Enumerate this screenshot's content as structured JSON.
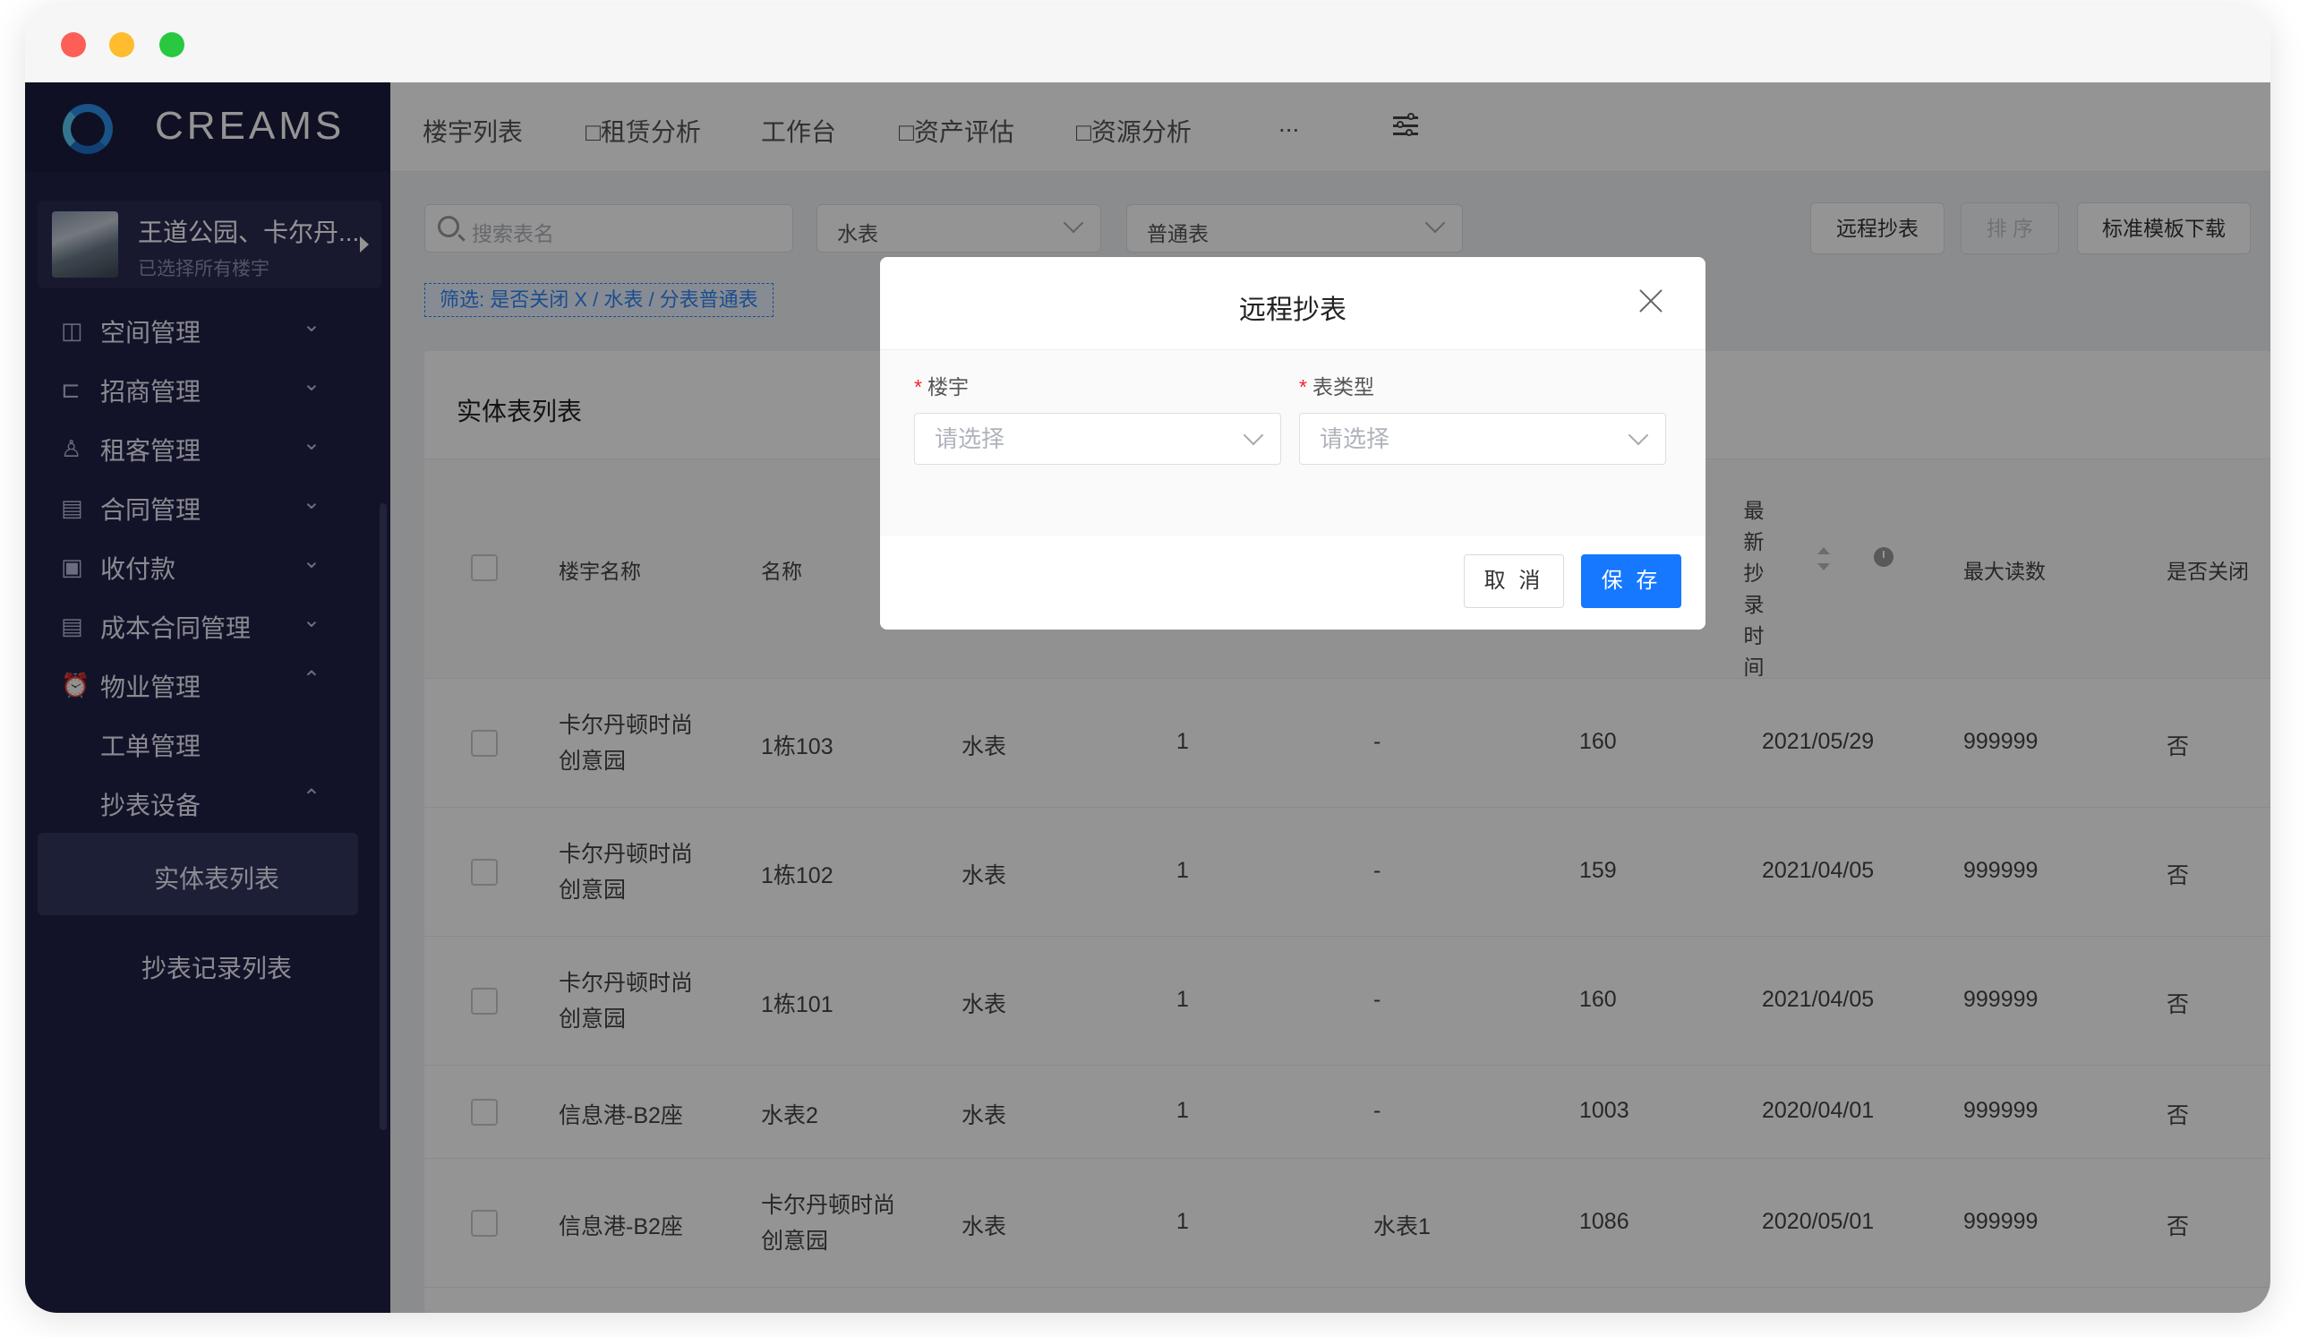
{
  "brand": {
    "name": "CREAMS"
  },
  "project": {
    "name": "王道公园、卡尔丹...",
    "subtitle": "已选择所有楼宇"
  },
  "sidebar": {
    "items": [
      {
        "label": "空间管理",
        "icon": "space-icon",
        "chevron": "⌄"
      },
      {
        "label": "招商管理",
        "icon": "investment-icon",
        "chevron": "⌄"
      },
      {
        "label": "租客管理",
        "icon": "tenant-icon",
        "chevron": "⌄"
      },
      {
        "label": "合同管理",
        "icon": "contract-icon",
        "chevron": "⌄"
      },
      {
        "label": "收付款",
        "icon": "payment-icon",
        "chevron": "⌄"
      },
      {
        "label": "成本合同管理",
        "icon": "cost-contract-icon",
        "chevron": "⌄"
      },
      {
        "label": "物业管理",
        "icon": "property-icon",
        "chevron": "⌃"
      }
    ],
    "sub_items": [
      {
        "label": "工单管理"
      },
      {
        "label": "抄表设备",
        "chevron": "⌃"
      }
    ],
    "active_item": {
      "label": "实体表列表"
    },
    "partial_item": {
      "label": "抄表记录列表"
    }
  },
  "topnav": {
    "tabs": [
      "楼宇列表",
      "□租赁分析",
      "工作台",
      "□资产评估",
      "□资源分析",
      "..."
    ]
  },
  "toolbar": {
    "search_placeholder": "搜索表名",
    "meter_type_value": "水表",
    "table_type_value": "普通表",
    "remote_read_label": "远程抄表",
    "sort_label": "排 序",
    "template_download_label": "标准模板下载"
  },
  "filter": {
    "text": "筛选:  是否关闭   X   /   水表   /   分表普通表"
  },
  "table": {
    "title": "实体表列表",
    "headers": {
      "building": "楼宇名称",
      "name": "名称",
      "latest_time": "最新抄录时间",
      "max_reading": "最大读数",
      "closed": "是否关闭"
    },
    "rows": [
      {
        "building": [
          "卡尔丹顿时尚",
          "创意园"
        ],
        "name": [
          "1栋103"
        ],
        "type": "水表",
        "multiplier": "1",
        "parent": "-",
        "reading": "160",
        "date": "2021/05/29",
        "max": "999999",
        "closed": "否"
      },
      {
        "building": [
          "卡尔丹顿时尚",
          "创意园"
        ],
        "name": [
          "1栋102"
        ],
        "type": "水表",
        "multiplier": "1",
        "parent": "-",
        "reading": "159",
        "date": "2021/04/05",
        "max": "999999",
        "closed": "否"
      },
      {
        "building": [
          "卡尔丹顿时尚",
          "创意园"
        ],
        "name": [
          "1栋101"
        ],
        "type": "水表",
        "multiplier": "1",
        "parent": "-",
        "reading": "160",
        "date": "2021/04/05",
        "max": "999999",
        "closed": "否"
      },
      {
        "building": [
          "信息港-B2座"
        ],
        "name": [
          "水表2"
        ],
        "type": "水表",
        "multiplier": "1",
        "parent": "-",
        "reading": "1003",
        "date": "2020/04/01",
        "max": "999999",
        "closed": "否"
      },
      {
        "building": [
          "信息港-B2座"
        ],
        "name": [
          "卡尔丹顿时尚",
          "创意园"
        ],
        "type": "水表",
        "multiplier": "1",
        "parent": "水表1",
        "reading": "1086",
        "date": "2020/05/01",
        "max": "999999",
        "closed": "否"
      }
    ]
  },
  "modal": {
    "title": "远程抄表",
    "fields": [
      {
        "label": "楼宇",
        "placeholder": "请选择"
      },
      {
        "label": "表类型",
        "placeholder": "请选择"
      }
    ],
    "cancel_label": "取 消",
    "save_label": "保 存"
  }
}
